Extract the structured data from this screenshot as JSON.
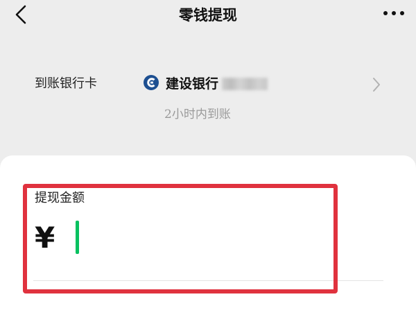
{
  "nav": {
    "title": "零钱提现",
    "back_icon": "chevron-left-icon",
    "more_icon": "more-dots-icon"
  },
  "bank": {
    "label": "到账银行卡",
    "logo_icon": "ccb-bank-logo",
    "name": "建设银行",
    "arrival_note": "2小时内到账",
    "chevron_icon": "chevron-right-icon"
  },
  "amount": {
    "label": "提现金额",
    "currency": "¥",
    "value": ""
  },
  "colors": {
    "page_bg": "#ededed",
    "card_bg": "#ffffff",
    "caret": "#07c160",
    "highlight": "#e0323e"
  }
}
